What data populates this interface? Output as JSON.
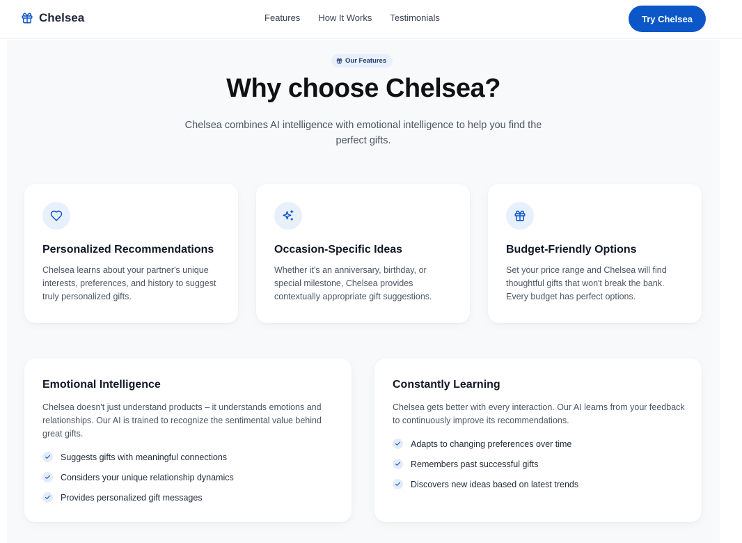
{
  "header": {
    "brand": "Chelsea",
    "brand_icon": "gift-icon",
    "nav": [
      "Features",
      "How It Works",
      "Testimonials"
    ],
    "cta": "Try Chelsea"
  },
  "colors": {
    "accent": "#0b57c8",
    "icon_bg": "#e8f0fb",
    "section_bg": "#f8f9fa"
  },
  "features": {
    "badge": "Our Features",
    "title": "Why choose Chelsea?",
    "subtitle": "Chelsea combines AI intelligence with emotional intelligence to help you find the perfect gifts.",
    "cards": [
      {
        "icon": "heart-icon",
        "title": "Personalized Recommendations",
        "description": "Chelsea learns about your partner's unique interests, preferences, and history to suggest truly personalized gifts."
      },
      {
        "icon": "sparkles-icon",
        "title": "Occasion-Specific Ideas",
        "description": "Whether it's an anniversary, birthday, or special milestone, Chelsea provides contextually appropriate gift suggestions."
      },
      {
        "icon": "gift-icon",
        "title": "Budget-Friendly Options",
        "description": "Set your price range and Chelsea will find thoughtful gifts that won't break the bank. Every budget has perfect options."
      }
    ],
    "wide_cards": [
      {
        "title": "Emotional Intelligence",
        "description": "Chelsea doesn't just understand products – it understands emotions and relationships. Our AI is trained to recognize the sentimental value behind great gifts.",
        "items": [
          "Suggests gifts with meaningful connections",
          "Considers your unique relationship dynamics",
          "Provides personalized gift messages"
        ]
      },
      {
        "title": "Constantly Learning",
        "description": "Chelsea gets better with every interaction. Our AI learns from your feedback to continuously improve its recommendations.",
        "items": [
          "Adapts to changing preferences over time",
          "Remembers past successful gifts",
          "Discovers new ideas based on latest trends"
        ]
      }
    ]
  }
}
